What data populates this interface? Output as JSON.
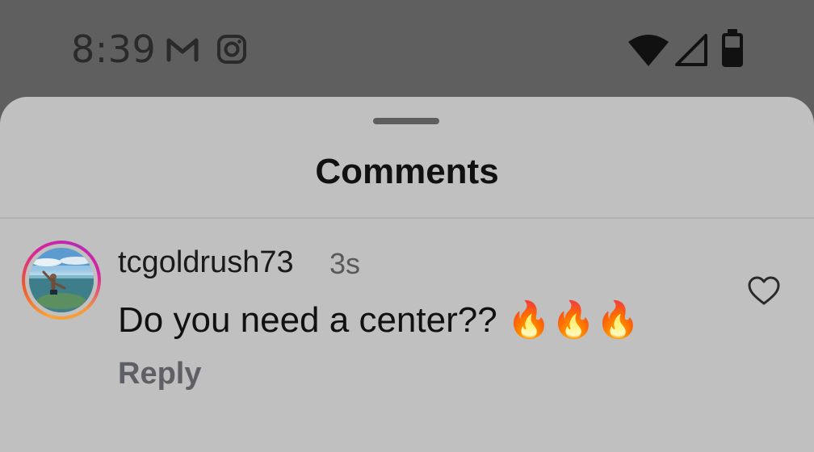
{
  "status_bar": {
    "time": "8:39",
    "icons": [
      "gmail-icon",
      "instagram-icon",
      "wifi-icon",
      "signal-icon",
      "battery-icon"
    ]
  },
  "sheet": {
    "title": "Comments"
  },
  "comments": [
    {
      "username": "tcgoldrush73",
      "timestamp": "3s",
      "text": "Do you need a center?? 🔥🔥🔥",
      "reply_label": "Reply"
    }
  ],
  "colors": {
    "scrim": "#5f5f5f",
    "sheet_bg": "#c0c0c0",
    "text_primary": "#111111",
    "text_secondary": "#5a5a5a"
  }
}
